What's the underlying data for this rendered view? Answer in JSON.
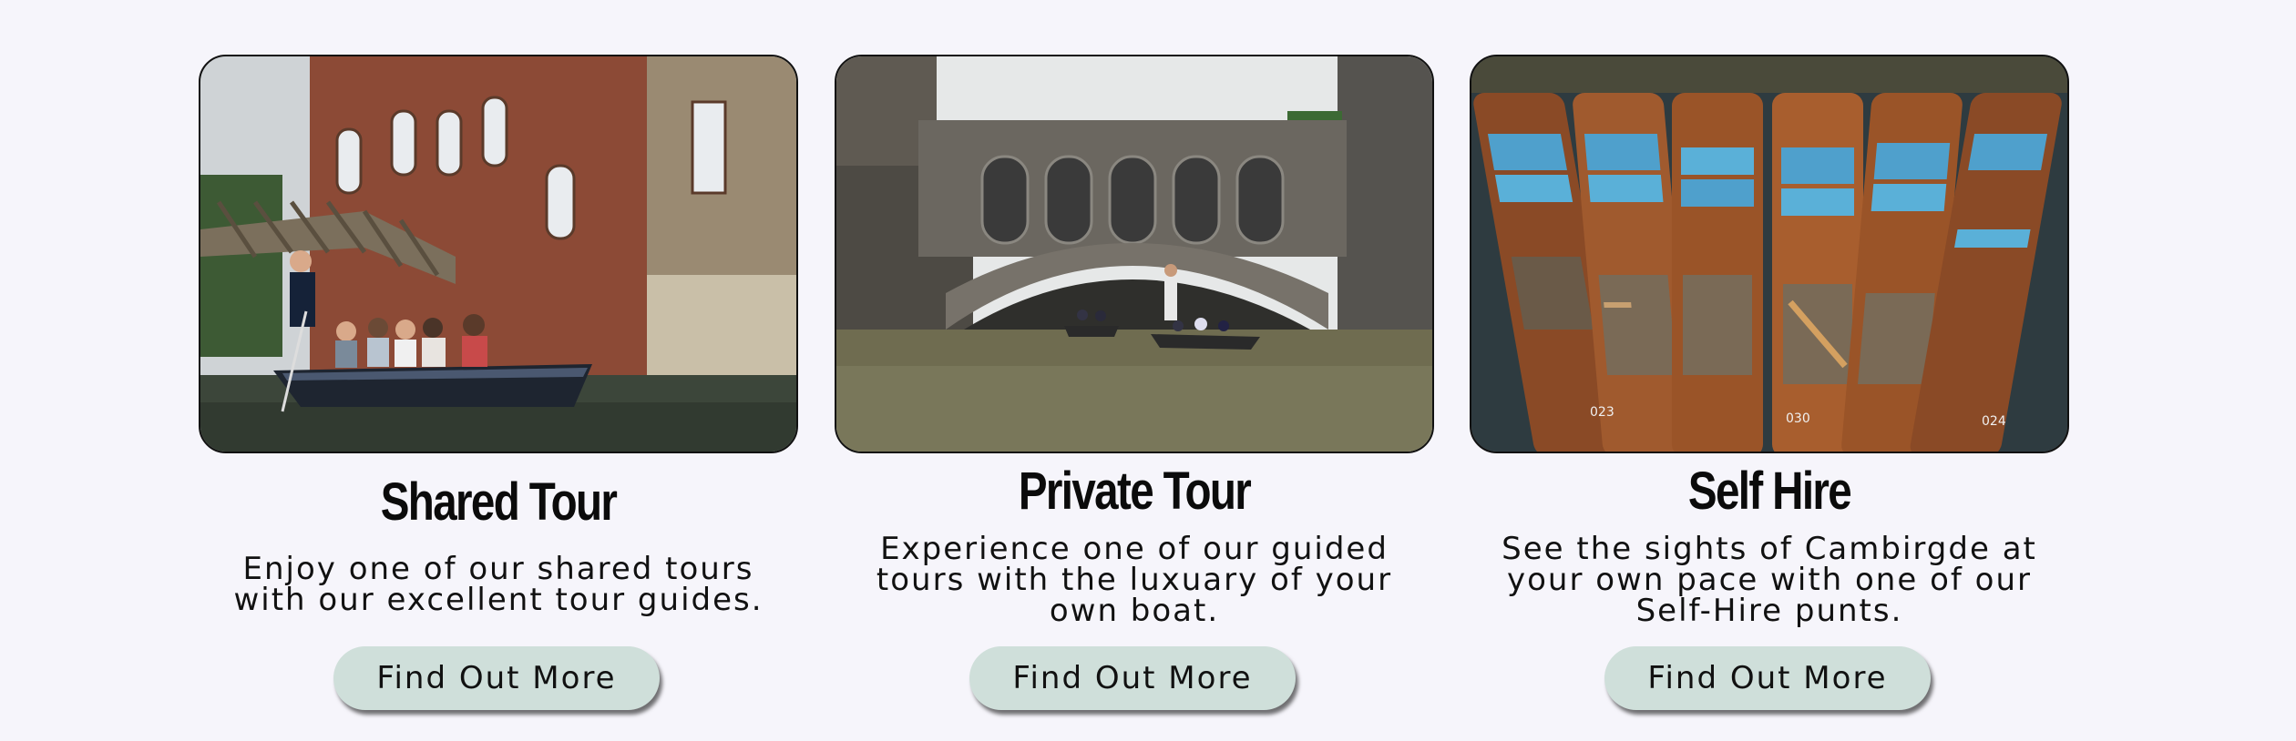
{
  "cards": [
    {
      "title": "Shared Tour",
      "description_lines": [
        "Enjoy one of our shared tours",
        "with our excellent tour guides."
      ],
      "button_label": "Find Out More",
      "image": "punting-on-river-under-wooden-bridge"
    },
    {
      "title": "Private Tour",
      "description_lines": [
        "Experience one of our guided",
        "tours with the luxuary of your",
        "own boat."
      ],
      "button_label": "Find Out More",
      "image": "bridge-of-sighs-punts"
    },
    {
      "title": "Self Hire",
      "description_lines": [
        "See the sights of Cambirgde at",
        "your own pace with one of our",
        "Self-Hire punts."
      ],
      "button_label": "Find Out More",
      "image": "moored-punts-with-blue-cushions"
    }
  ],
  "colors": {
    "background": "#f6f5fb",
    "button": "#cfdfda",
    "text": "#111111"
  },
  "boat_numbers": [
    "023",
    "030",
    "024"
  ]
}
